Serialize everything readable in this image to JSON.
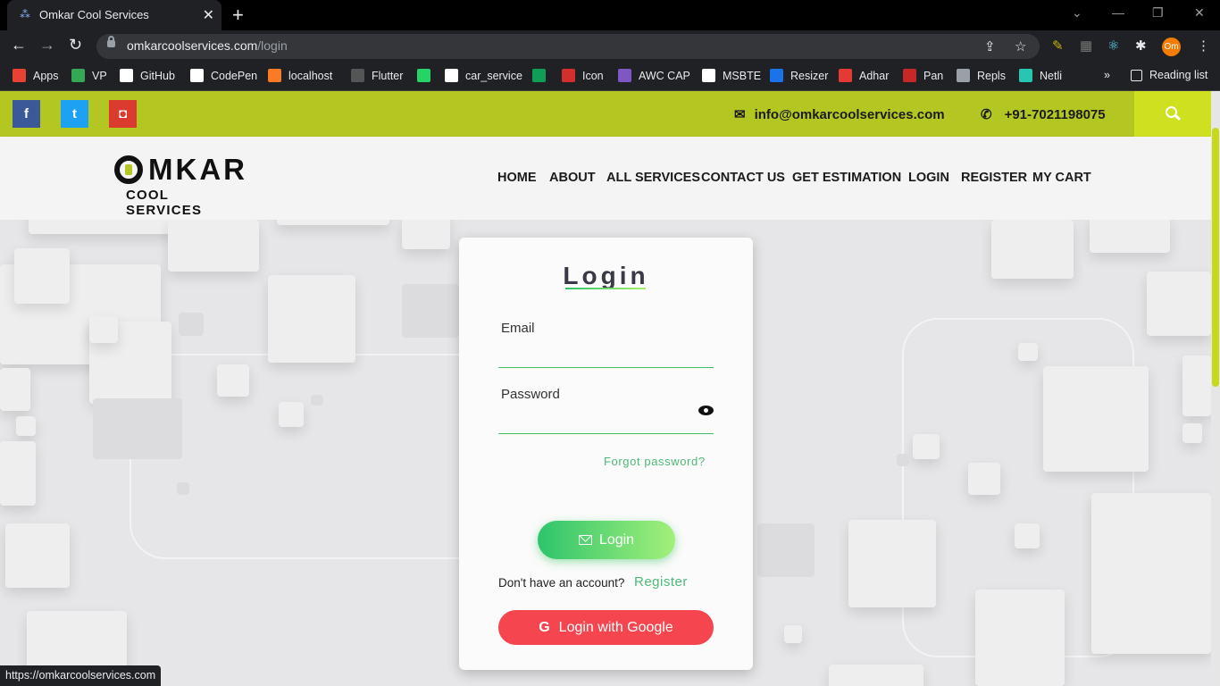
{
  "browser": {
    "tab_title": "Omkar Cool Services",
    "close_glyph": "✕",
    "new_tab_glyph": "+",
    "url_host": "omkarcoolservices.com",
    "url_path": "/login",
    "status_url": "https://omkarcoolservices.com"
  },
  "bookmarks": [
    {
      "label": "Apps",
      "icon": "apps-grid-icon",
      "color": "#e94235"
    },
    {
      "label": "VP",
      "icon": "vp-icon",
      "color": "#34a853"
    },
    {
      "label": "GitHub",
      "icon": "github-icon",
      "color": "#ffffff"
    },
    {
      "label": "CodePen",
      "icon": "codepen-icon",
      "color": "#ffffff"
    },
    {
      "label": "localhost",
      "icon": "xampp-icon",
      "color": "#fb7a24"
    },
    {
      "label": "Flutter",
      "icon": "github-icon",
      "color": "#555555"
    },
    {
      "label": "",
      "icon": "whatsapp-icon",
      "color": "#25d366"
    },
    {
      "label": "car_service",
      "icon": "github-icon",
      "color": "#ffffff"
    },
    {
      "label": "",
      "icon": "sheet-icon",
      "color": "#0f9d58"
    },
    {
      "label": "Icon",
      "icon": "icon-grid-icon",
      "color": "#d32f2f"
    },
    {
      "label": "AWC CAP",
      "icon": "awc-icon",
      "color": "#7e57c2"
    },
    {
      "label": "MSBTE",
      "icon": "msbte-icon",
      "color": "#ffffff"
    },
    {
      "label": "Resizer",
      "icon": "pdf-icon",
      "color": "#1a73e8"
    },
    {
      "label": "Adhar",
      "icon": "aadhaar-icon",
      "color": "#e53935"
    },
    {
      "label": "Pan",
      "icon": "nsdl-icon",
      "color": "#c62828"
    },
    {
      "label": "Repls",
      "icon": "replit-icon",
      "color": "#9aa0a6"
    },
    {
      "label": "Netli",
      "icon": "netlify-icon",
      "color": "#26c6b0"
    }
  ],
  "reading_list": "Reading list",
  "more_bookmarks": "»",
  "profile_initials": "Om",
  "site": {
    "social": [
      {
        "name": "facebook",
        "glyph": "f",
        "color": "#3b5998"
      },
      {
        "name": "twitter",
        "glyph": "t",
        "color": "#1da1f2"
      },
      {
        "name": "instagram",
        "glyph": "◘",
        "color": "#db3b2e"
      }
    ],
    "email": "info@omkarcoolservices.com",
    "phone": "+91-7021198075",
    "logo_top": "MKAR",
    "logo_bottom": "COOL SERVICES",
    "nav": [
      "HOME",
      "ABOUT",
      "ALL SERVICES",
      "CONTACT US",
      "GET ESTIMATION",
      "LOGIN",
      "REGISTER",
      "MY CART"
    ],
    "brand_color": "#b4c622"
  },
  "login": {
    "title": "Login",
    "email_label": "Email",
    "email_value": "",
    "password_label": "Password",
    "password_value": "",
    "forgot": "Forgot password?",
    "login_button": "Login",
    "no_account": "Don't have an account?",
    "register_link": "Register",
    "google_button": "Login with Google"
  }
}
